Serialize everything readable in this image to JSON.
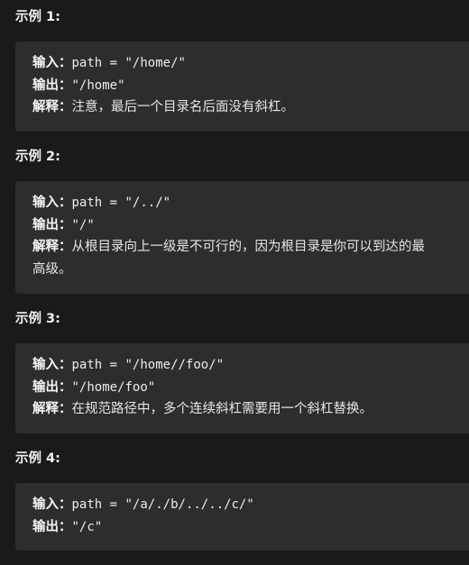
{
  "examples": [
    {
      "title": "示例 1:",
      "input_label": "输入：",
      "input_value": "path = \"/home/\"",
      "output_label": "输出：",
      "output_value": "\"/home\"",
      "explain_label": "解释：",
      "explain_line1": "注意，最后一个目录名后面没有斜杠。"
    },
    {
      "title": "示例 2:",
      "input_label": "输入：",
      "input_value": "path = \"/../\"",
      "output_label": "输出：",
      "output_value": "\"/\"",
      "explain_label": "解释：",
      "explain_line1": "从根目录向上一级是不可行的，因为根目录是你可以到达的最",
      "explain_line2": "高级。"
    },
    {
      "title": "示例 3:",
      "input_label": "输入：",
      "input_value": "path = \"/home//foo/\"",
      "output_label": "输出：",
      "output_value": "\"/home/foo\"",
      "explain_label": "解释：",
      "explain_line1": "在规范路径中，多个连续斜杠需要用一个斜杠替换。"
    },
    {
      "title": "示例 4:",
      "input_label": "输入：",
      "input_value": "path = \"/a/./b/../../c/\"",
      "output_label": "输出：",
      "output_value": "\"/c\""
    }
  ]
}
